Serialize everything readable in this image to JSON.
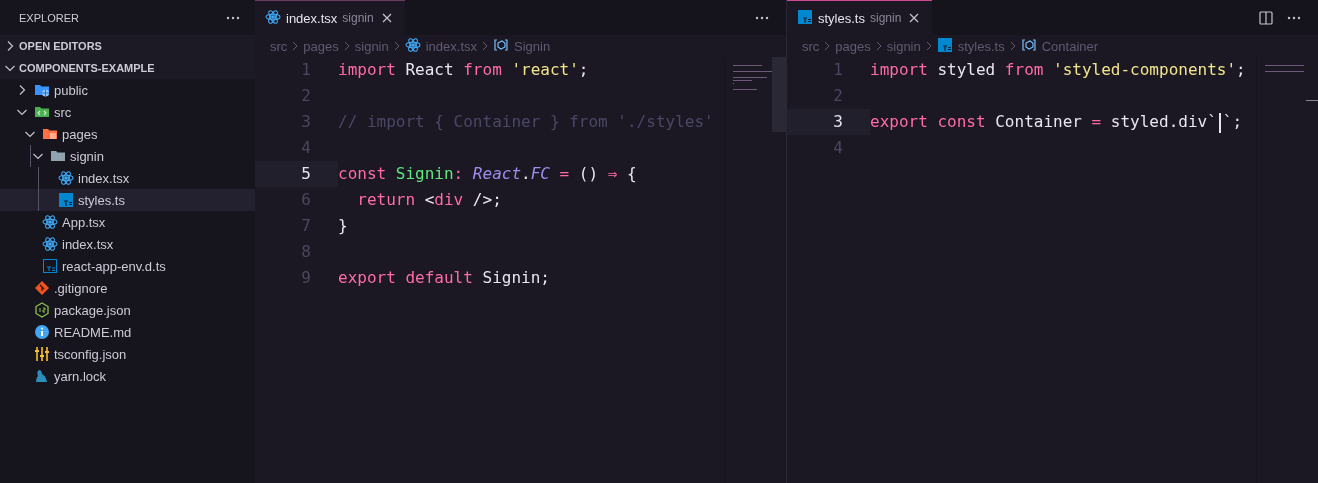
{
  "sidebar": {
    "title": "EXPLORER",
    "sections": [
      {
        "label": "OPEN EDITORS",
        "expanded": false
      },
      {
        "label": "COMPONENTS-EXAMPLE",
        "expanded": true,
        "tree": [
          {
            "label": "public",
            "kind": "folder-public",
            "expanded": false,
            "selected": false
          },
          {
            "label": "src",
            "kind": "folder-src",
            "expanded": true,
            "selected": false,
            "children": [
              {
                "label": "pages",
                "kind": "folder-pages",
                "expanded": true,
                "selected": false,
                "children": [
                  {
                    "label": "signin",
                    "kind": "folder",
                    "expanded": true,
                    "selected": false,
                    "children": [
                      {
                        "label": "index.tsx",
                        "kind": "react",
                        "selected": false
                      },
                      {
                        "label": "styles.ts",
                        "kind": "ts",
                        "selected": true
                      }
                    ]
                  }
                ]
              },
              {
                "label": "App.tsx",
                "kind": "react",
                "selected": false
              },
              {
                "label": "index.tsx",
                "kind": "react",
                "selected": false
              },
              {
                "label": "react-app-env.d.ts",
                "kind": "ts-outline",
                "selected": false
              }
            ]
          },
          {
            "label": ".gitignore",
            "kind": "git",
            "selected": false
          },
          {
            "label": "package.json",
            "kind": "node",
            "selected": false
          },
          {
            "label": "README.md",
            "kind": "info",
            "selected": false
          },
          {
            "label": "tsconfig.json",
            "kind": "config",
            "selected": false
          },
          {
            "label": "yarn.lock",
            "kind": "yarn",
            "selected": false
          }
        ]
      }
    ]
  },
  "editors": [
    {
      "focused": false,
      "tab": {
        "label": "index.tsx",
        "description": "signin",
        "kind": "react",
        "selected": true
      },
      "breadcrumbs": [
        {
          "label": "src",
          "kind": "folder"
        },
        {
          "label": "pages",
          "kind": "folder"
        },
        {
          "label": "signin",
          "kind": "folder"
        },
        {
          "label": "index.tsx",
          "kind": "react"
        },
        {
          "label": "Signin",
          "kind": "symbol"
        }
      ],
      "lines": [
        {
          "number": "1",
          "current": false,
          "tokens": [
            {
              "kind": "kw",
              "text": "import"
            },
            {
              "kind": "plain",
              "text": " React "
            },
            {
              "kind": "kw",
              "text": "from "
            },
            {
              "kind": "str",
              "text": "'react'"
            },
            {
              "kind": "plain",
              "text": ";"
            }
          ]
        },
        {
          "number": "2",
          "current": false
        },
        {
          "number": "3",
          "current": false,
          "tokens": [
            {
              "kind": "comment",
              "text": "// import { Container } from './styles'"
            }
          ]
        },
        {
          "number": "4",
          "current": false
        },
        {
          "number": "5",
          "current": true,
          "tokens": [
            {
              "kind": "kw",
              "text": "const "
            },
            {
              "kind": "fn",
              "text": "Signin"
            },
            {
              "kind": "kw",
              "text": ": "
            },
            {
              "kind": "type",
              "text": "React"
            },
            {
              "kind": "plain",
              "text": "."
            },
            {
              "kind": "type",
              "text": "FC"
            },
            {
              "kind": "kw",
              "text": " = "
            },
            {
              "kind": "plain",
              "text": "() "
            },
            {
              "kind": "kw",
              "text": "⇒ "
            },
            {
              "kind": "plain",
              "text": "{"
            }
          ]
        },
        {
          "number": "6",
          "current": false,
          "tokens": [
            {
              "kind": "kw",
              "text": "  return"
            },
            {
              "kind": "plain",
              "text": " <"
            },
            {
              "kind": "kw",
              "text": "div"
            },
            {
              "kind": "plain",
              "text": " />;"
            }
          ]
        },
        {
          "number": "7",
          "current": false,
          "tokens": [
            {
              "kind": "plain",
              "text": "}"
            }
          ]
        },
        {
          "number": "8",
          "current": false
        },
        {
          "number": "9",
          "current": false,
          "tokens": [
            {
              "kind": "kw",
              "text": "export default"
            },
            {
              "kind": "plain",
              "text": " Signin;"
            }
          ]
        }
      ]
    },
    {
      "focused": true,
      "tab": {
        "label": "styles.ts",
        "description": "signin",
        "kind": "ts",
        "selected": true
      },
      "breadcrumbs": [
        {
          "label": "src",
          "kind": "folder"
        },
        {
          "label": "pages",
          "kind": "folder"
        },
        {
          "label": "signin",
          "kind": "folder"
        },
        {
          "label": "styles.ts",
          "kind": "ts"
        },
        {
          "label": "Container",
          "kind": "symbol"
        }
      ],
      "lines": [
        {
          "number": "1",
          "current": false,
          "tokens": [
            {
              "kind": "kw",
              "text": "import"
            },
            {
              "kind": "plain",
              "text": " styled "
            },
            {
              "kind": "kw",
              "text": "from "
            },
            {
              "kind": "str",
              "text": "'styled-components'"
            },
            {
              "kind": "plain",
              "text": ";"
            }
          ]
        },
        {
          "number": "2",
          "current": false
        },
        {
          "number": "3",
          "current": true,
          "tokens": [
            {
              "kind": "kw",
              "text": "export const"
            },
            {
              "kind": "plain",
              "text": " Container "
            },
            {
              "kind": "kw",
              "text": "="
            },
            {
              "kind": "plain",
              "text": " styled.div`"
            },
            {
              "kind": "cursor"
            },
            {
              "kind": "plain",
              "text": "`;"
            }
          ]
        },
        {
          "number": "4",
          "current": false
        }
      ]
    }
  ]
}
